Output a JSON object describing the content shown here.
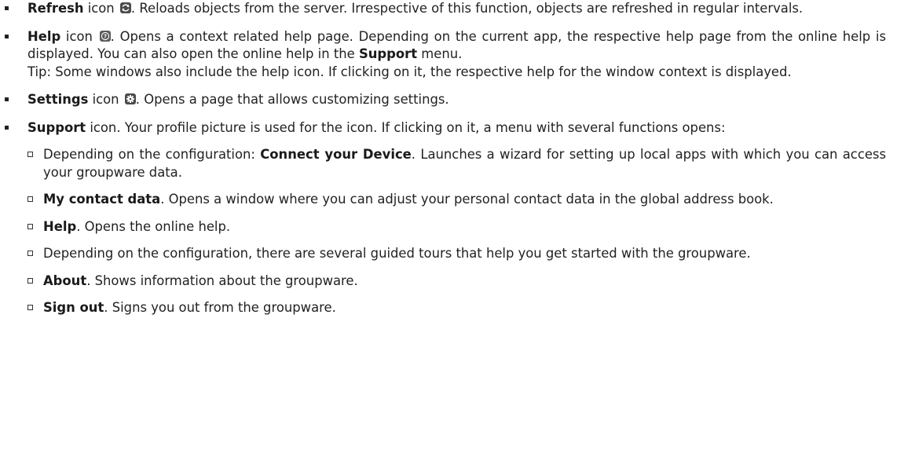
{
  "items": [
    {
      "term": "Refresh",
      "icon_word": "icon",
      "icon": "refresh-icon",
      "text": ". Reloads objects from the server. Irrespective of this function, objects are refreshed in regular intervals."
    },
    {
      "term": "Help",
      "icon_word": "icon",
      "icon": "help-icon",
      "text_a": ". Opens a context related help page. Depending on the current app, the respective help page from the online help is displayed. You can also open the online help in the ",
      "support_link": "Support",
      "text_b": " menu.",
      "tip": "Tip: Some windows also include the help icon. If clicking on it, the respective help for the window context is displayed."
    },
    {
      "term": "Settings",
      "icon_word": "icon",
      "icon": "gear-icon",
      "text": ". Opens a page that allows customizing settings."
    },
    {
      "term": "Support",
      "text": " icon. Your profile picture is used for the icon. If clicking on it, a menu with several functions opens:",
      "subitems": [
        {
          "prefix": "Depending on the configuration: ",
          "term": "Connect your Device",
          "text": ". Launches a wizard for setting up local apps with which you can access your groupware data."
        },
        {
          "prefix": "",
          "term": "My contact data",
          "text": ". Opens a window where you can adjust your personal contact data in the global address book."
        },
        {
          "prefix": "",
          "term": "Help",
          "text": ". Opens the online help."
        },
        {
          "prefix": "Depending on the configuration, there are several guided tours that help you get started with the groupware.",
          "term": "",
          "text": ""
        },
        {
          "prefix": "",
          "term": "About",
          "text": ". Shows information about the groupware."
        },
        {
          "prefix": "",
          "term": "Sign out",
          "text": ". Signs you out from the groupware."
        }
      ]
    }
  ],
  "colors": {
    "icon_bg": "#4a4a4a",
    "icon_fg": "#ffffff",
    "text": "#222222"
  }
}
